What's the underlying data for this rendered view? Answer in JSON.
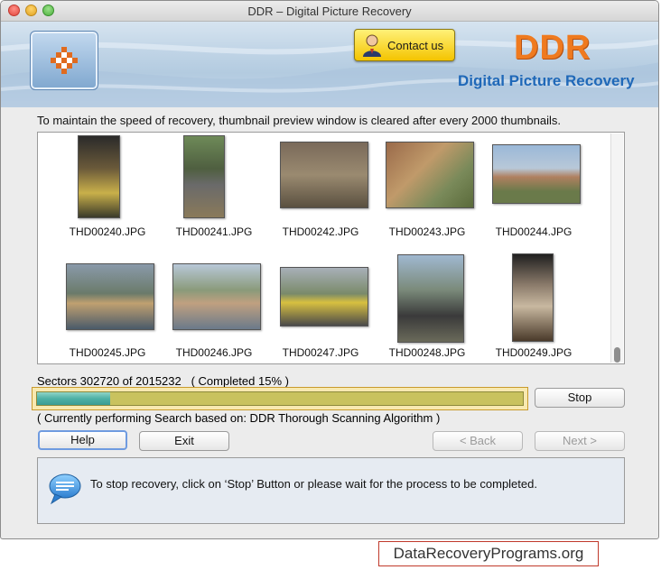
{
  "window": {
    "title": "DDR – Digital Picture Recovery"
  },
  "banner": {
    "contact_label": "Contact us",
    "brand": "DDR",
    "product": "Digital Picture Recovery"
  },
  "notice": "To maintain the speed of recovery, thumbnail preview window is cleared after every 2000 thumbnails.",
  "thumbnails": [
    {
      "name": "THD00240.JPG"
    },
    {
      "name": "THD00241.JPG"
    },
    {
      "name": "THD00242.JPG"
    },
    {
      "name": "THD00243.JPG"
    },
    {
      "name": "THD00244.JPG"
    },
    {
      "name": "THD00245.JPG"
    },
    {
      "name": "THD00246.JPG"
    },
    {
      "name": "THD00247.JPG"
    },
    {
      "name": "THD00248.JPG"
    },
    {
      "name": "THD00249.JPG"
    }
  ],
  "progress": {
    "sectors_text": "Sectors 302720 of 2015232   ( Completed 15% )",
    "percent": 15,
    "status": "( Currently performing Search based on: DDR Thorough Scanning Algorithm )"
  },
  "buttons": {
    "stop": "Stop",
    "help": "Help",
    "exit": "Exit",
    "back": "< Back",
    "next": "Next >"
  },
  "info": {
    "icon": "chat-bubble-icon",
    "text": "To stop recovery, click on ‘Stop’ Button or please wait for the process to be completed."
  },
  "footer": {
    "site": "DataRecoveryPrograms.org"
  },
  "colors": {
    "brand_orange": "#ef7a1f",
    "brand_blue": "#1f68b8",
    "progress_fill": "#4db0a5"
  }
}
